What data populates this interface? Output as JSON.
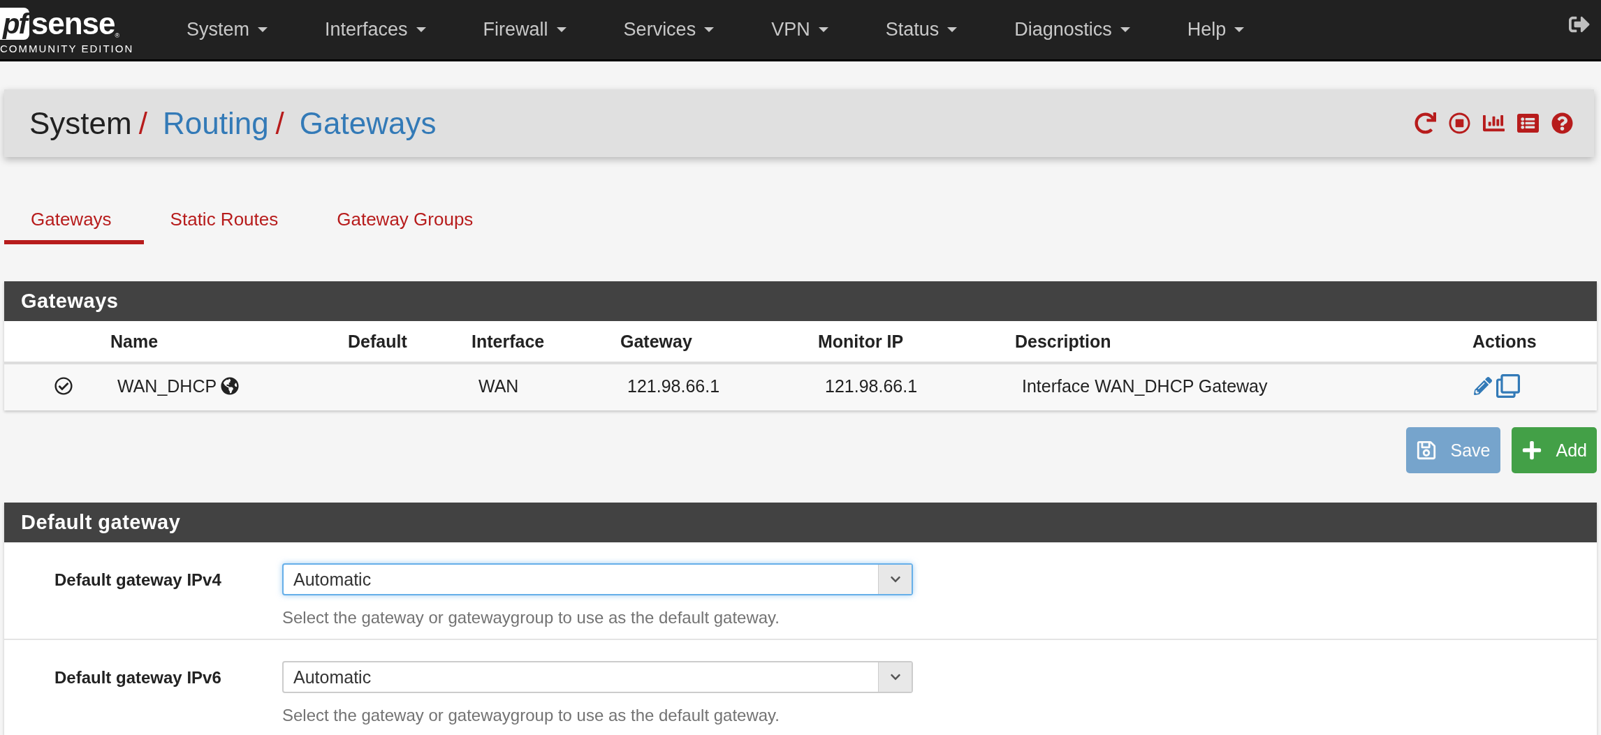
{
  "logo": {
    "mark": "pf",
    "name": "sense",
    "trademark": "®",
    "edition": "COMMUNITY EDITION"
  },
  "nav": [
    {
      "label": "System"
    },
    {
      "label": "Interfaces"
    },
    {
      "label": "Firewall"
    },
    {
      "label": "Services"
    },
    {
      "label": "VPN"
    },
    {
      "label": "Status"
    },
    {
      "label": "Diagnostics"
    },
    {
      "label": "Help"
    }
  ],
  "breadcrumb": [
    {
      "label": "System",
      "kind": "plain",
      "separator": "/"
    },
    {
      "label": "Routing",
      "kind": "link",
      "separator": "/"
    },
    {
      "label": "Gateways",
      "kind": "link"
    }
  ],
  "tabs": [
    {
      "label": "Gateways",
      "selected": true
    },
    {
      "label": "Static Routes",
      "selected": false
    },
    {
      "label": "Gateway Groups",
      "selected": false
    }
  ],
  "gateways_panel": {
    "title": "Gateways",
    "columns": [
      "Name",
      "Default",
      "Interface",
      "Gateway",
      "Monitor IP",
      "Description",
      "Actions"
    ],
    "rows": [
      {
        "active": true,
        "name": "WAN_DHCP",
        "default_gateway": true,
        "default": "",
        "interface": "WAN",
        "gateway": "121.98.66.1",
        "monitor_ip": "121.98.66.1",
        "description": "Interface WAN_DHCP Gateway"
      }
    ]
  },
  "buttons": [
    {
      "label": "Save",
      "kind": "save",
      "disabled": true
    },
    {
      "label": "Add",
      "kind": "add",
      "disabled": false
    }
  ],
  "default_gateway_panel": {
    "title": "Default gateway",
    "fields": [
      {
        "label": "Default gateway IPv4",
        "value": "Automatic",
        "focused": true,
        "help": "Select the gateway or gatewaygroup to use as the default gateway."
      },
      {
        "label": "Default gateway IPv6",
        "value": "Automatic",
        "focused": false,
        "help": "Select the gateway or gatewaygroup to use as the default gateway."
      }
    ]
  }
}
